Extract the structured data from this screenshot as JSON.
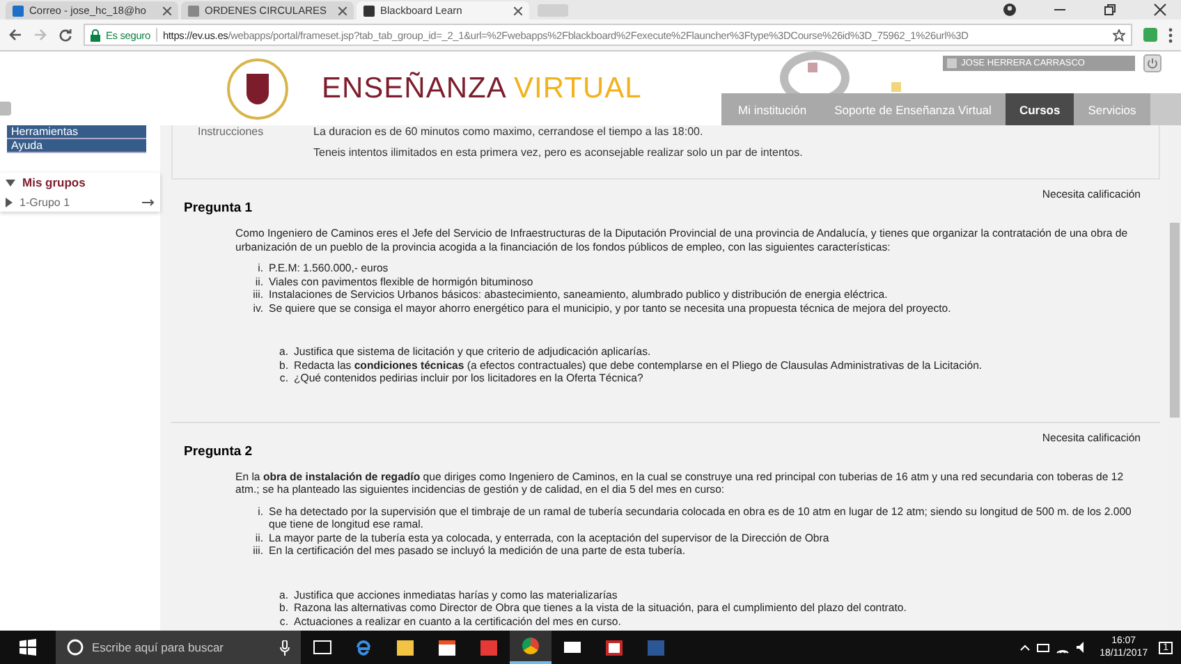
{
  "browser": {
    "tabs": [
      {
        "label": "Correo - jose_hc_18@ho",
        "selected": false,
        "kind": "mail"
      },
      {
        "label": "ORDENES CIRCULARES",
        "selected": false,
        "kind": "doc"
      },
      {
        "label": "Blackboard Learn",
        "selected": true,
        "kind": "bb"
      }
    ],
    "secure_label": "Es seguro",
    "url_host": "https://ev.us.es",
    "url_path": "/webapps/portal/frameset.jsp?tab_tab_group_id=_2_1&url=%2Fwebapps%2Fblackboard%2Fexecute%2Flauncher%3Ftype%3DCourse%26id%3D_75962_1%26url%3D"
  },
  "header": {
    "logo_word1": "ENSEÑANZA",
    "logo_word2": "VIRTUAL",
    "user": "JOSE HERRERA CARRASCO",
    "nav": [
      {
        "label": "Mi institución",
        "selected": false
      },
      {
        "label": "Soporte de Enseñanza Virtual",
        "selected": false
      },
      {
        "label": "Cursos",
        "selected": true
      },
      {
        "label": "Servicios",
        "selected": false
      }
    ]
  },
  "sidebar": {
    "items": [
      "Herramientas",
      "Ayuda"
    ],
    "groups_title": "Mis grupos",
    "groups": [
      {
        "label": "1-Grupo 1",
        "expanded": false
      }
    ]
  },
  "instructions": {
    "label": "Instrucciones",
    "lines": [
      "La duracion es de 60 minutos como maximo, cerrandose el tiempo a las 18:00.",
      "Teneis intentos ilimitados en esta primera vez, pero es aconsejable realizar solo un par de intentos."
    ]
  },
  "questions": [
    {
      "status": "Necesita calificación",
      "title": "Pregunta 1",
      "intro": "Como Ingeniero de Caminos eres el Jefe del Servicio de Infraestructuras de la Diputación Provincial de una provincia de Andalucía, y tienes que organizar la contratación de una obra de urbanización de un pueblo de la provincia acogida a la financiación de los fondos públicos de empleo, con las siguientes características:",
      "points": [
        {
          "n": "i.",
          "text": "P.E.M:  1.560.000,- euros"
        },
        {
          "n": "ii.",
          "text": "Viales con pavimentos flexible de hormigón bituminoso"
        },
        {
          "n": "iii.",
          "text": "Instalaciones de Servicios Urbanos básicos: abastecimiento, saneamiento, alumbrado publico y distribución de energia eléctrica."
        },
        {
          "n": "iv.",
          "text": "Se quiere que se consiga el mayor ahorro energético para el municipio, y por tanto se necesita una propuesta técnica de mejora del proyecto."
        }
      ],
      "tasks": [
        {
          "n": "a.",
          "text": "Justifica que sistema de licitación y que criterio de adjudicación aplicarías."
        },
        {
          "n": "b.",
          "text": "Redacta las **condiciones técnicas** (a efectos contractuales) que debe contemplarse en el Pliego de Clausulas Administrativas de la Licitación."
        },
        {
          "n": "c.",
          "text": "¿Qué contenidos pedirias incluir por los licitadores en la Oferta Técnica?"
        }
      ]
    },
    {
      "status": "Necesita calificación",
      "title": "Pregunta 2",
      "intro": "En la **obra de instalación de regadío** que diriges como Ingeniero de Caminos, en la cual se construye una red principal con tuberias de 16 atm y una red secundaria con toberas de 12 atm.; se ha planteado las siguientes incidencias de gestión y de calidad, en el dia 5 del mes en curso:",
      "points": [
        {
          "n": "i.",
          "text": "Se ha detectado por la supervisión que el timbraje de un ramal de tubería secundaria colocada en obra es de 10 atm en lugar de 12 atm; siendo su longitud de 500 m. de los 2.000 que tiene de longitud ese ramal."
        },
        {
          "n": "ii.",
          "text": "La mayor parte de la tubería esta ya colocada, y enterrada, con la aceptación del supervisor de la Dirección de Obra"
        },
        {
          "n": "iii.",
          "text": "En la certificación del mes pasado se incluyó la medición de una parte de esta tubería."
        }
      ],
      "tasks": [
        {
          "n": "a.",
          "text": "Justifica que acciones inmediatas harías y como las materializarías"
        },
        {
          "n": "b.",
          "text": "Razona las alternativas como Director de Obra que tienes a la vista de la situación, para el cumplimiento del plazo del contrato."
        },
        {
          "n": "c.",
          "text": "Actuaciones a realizar en cuanto a la certificación del mes en curso."
        }
      ]
    }
  ],
  "taskbar": {
    "search_placeholder": "Escribe aquí para buscar",
    "time": "16:07",
    "date": "18/11/2017",
    "notifications": "1"
  }
}
